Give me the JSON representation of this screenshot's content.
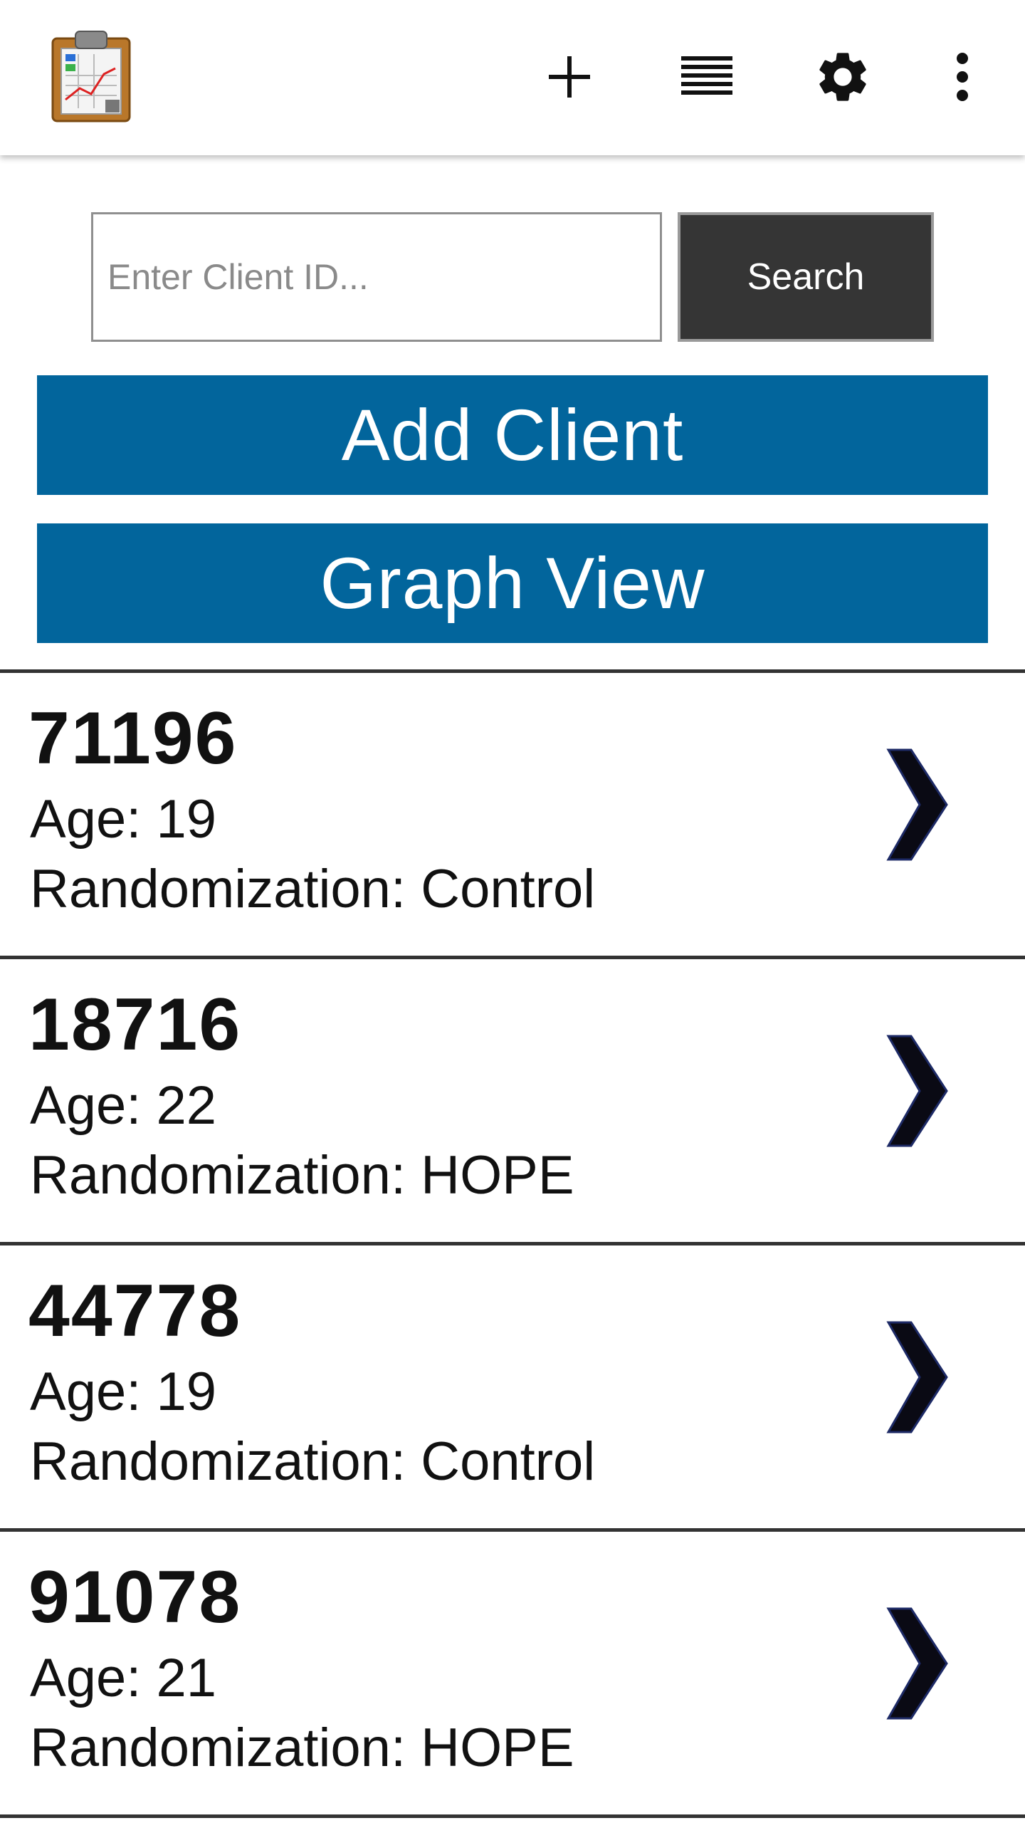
{
  "appbar": {
    "logo_icon": "clipboard-chart-icon",
    "actions": [
      {
        "icon": "plus-icon"
      },
      {
        "icon": "list-icon"
      },
      {
        "icon": "gear-icon"
      },
      {
        "icon": "more-vert-icon"
      }
    ]
  },
  "search": {
    "placeholder": "Enter Client ID...",
    "value": "",
    "button_label": "Search"
  },
  "buttons": {
    "add_client": "Add Client",
    "graph_view": "Graph View"
  },
  "colors": {
    "primary": "#02659c",
    "search_button": "#353535",
    "chevron": "#0a0a14"
  },
  "clients": [
    {
      "id": "71196",
      "age": "Age: 19",
      "randomization": "Randomization: Control"
    },
    {
      "id": "18716",
      "age": "Age: 22",
      "randomization": "Randomization: HOPE"
    },
    {
      "id": "44778",
      "age": "Age: 19",
      "randomization": "Randomization: Control"
    },
    {
      "id": "91078",
      "age": "Age: 21",
      "randomization": "Randomization: HOPE"
    }
  ]
}
